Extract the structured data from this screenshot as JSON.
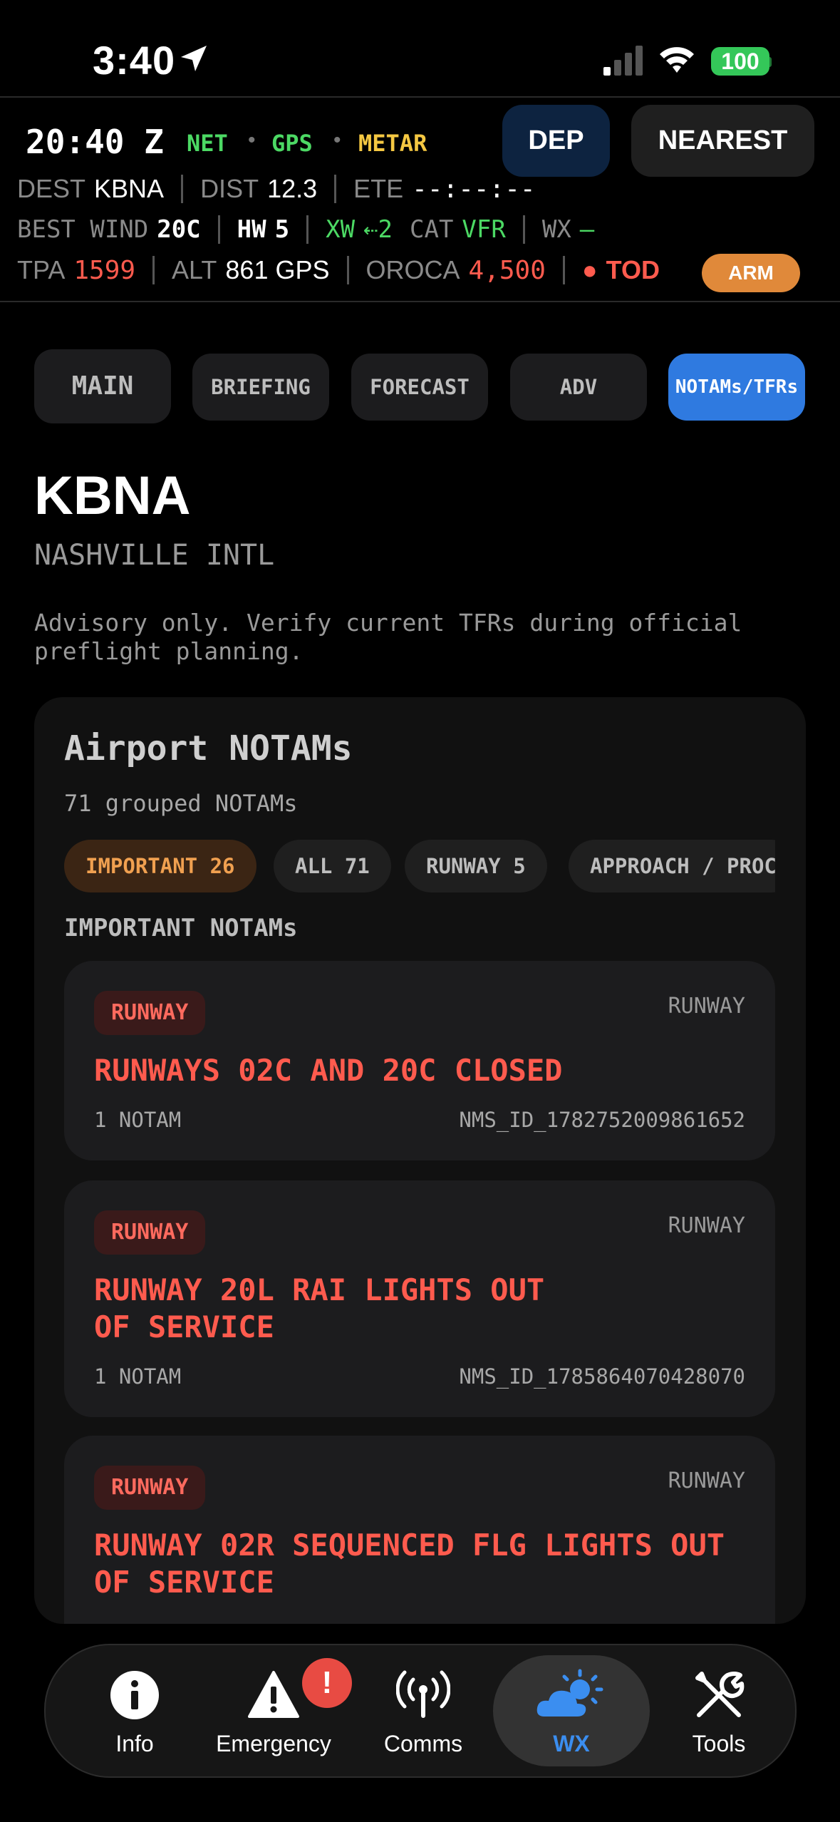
{
  "status_bar": {
    "time": "3:40",
    "battery": "100"
  },
  "header": {
    "zulu": "20:40 Z",
    "tags": [
      {
        "label": "NET",
        "color": "#4cd964"
      },
      {
        "label": "GPS",
        "color": "#4cd964"
      },
      {
        "label": "METAR",
        "color": "#f5c842"
      }
    ],
    "dep_label": "DEP",
    "nearest_label": "NEAREST",
    "row1": {
      "dest_label": "DEST",
      "dest_value": "KBNA",
      "dist_label": "DIST",
      "dist_value": "12.3",
      "ete_label": "ETE",
      "ete_value": "--:--:--"
    },
    "row2": {
      "best_wind_label": "BEST WIND",
      "best_wind_value": "20C",
      "hw_label": "HW",
      "hw_value": "5",
      "xw_label": "XW",
      "xw_value": "⇠2",
      "cat_label": "CAT",
      "cat_value": "VFR",
      "wx_label": "WX",
      "wx_value": "—"
    },
    "row3": {
      "tpa_label": "TPA",
      "tpa_value": "1599",
      "alt_label": "ALT",
      "alt_value": "861 GPS",
      "oroca_label": "OROCA",
      "oroca_value": "4,500",
      "tod_label": "TOD",
      "arm_label": "ARM"
    }
  },
  "tabs": [
    {
      "label": "MAIN"
    },
    {
      "label": "BRIEFING"
    },
    {
      "label": "FORECAST"
    },
    {
      "label": "ADV"
    },
    {
      "label": "NOTAMs/TFRs"
    }
  ],
  "airport": {
    "id": "KBNA",
    "name": "NASHVILLE INTL",
    "advisory": "Advisory only. Verify current TFRs during official preflight planning."
  },
  "notams": {
    "title": "Airport NOTAMs",
    "count_text": "71 grouped NOTAMs",
    "chips": [
      {
        "label": "IMPORTANT 26"
      },
      {
        "label": "ALL 71"
      },
      {
        "label": "RUNWAY 5"
      },
      {
        "label": "APPROACH / PROC"
      }
    ],
    "section_title": "IMPORTANT NOTAMs",
    "cards": [
      {
        "badge": "RUNWAY",
        "category": "RUNWAY",
        "title": "RUNWAYS 02C AND 20C CLOSED",
        "count": "1 NOTAM",
        "id": "NMS_ID_1782752009861652"
      },
      {
        "badge": "RUNWAY",
        "category": "RUNWAY",
        "title": "RUNWAY 20L RAI LIGHTS OUT OF SERVICE",
        "count": "1 NOTAM",
        "id": "NMS_ID_1785864070428070"
      },
      {
        "badge": "RUNWAY",
        "category": "RUNWAY",
        "title": "RUNWAY 02R SEQUENCED FLG LIGHTS OUT OF SERVICE",
        "count": "",
        "id": ""
      }
    ]
  },
  "nav": {
    "items": [
      {
        "label": "Info",
        "icon": "info-icon"
      },
      {
        "label": "Emergency",
        "icon": "warning-icon"
      },
      {
        "label": "Comms",
        "icon": "antenna-icon"
      },
      {
        "label": "WX",
        "icon": "weather-icon"
      },
      {
        "label": "Tools",
        "icon": "tools-icon"
      }
    ],
    "alert_badge": "!"
  },
  "colors": {
    "accent": "#2f7ae0",
    "alert_red": "#ff5b4e",
    "ok_green": "#4cd964",
    "arm_orange": "#e0893a"
  }
}
